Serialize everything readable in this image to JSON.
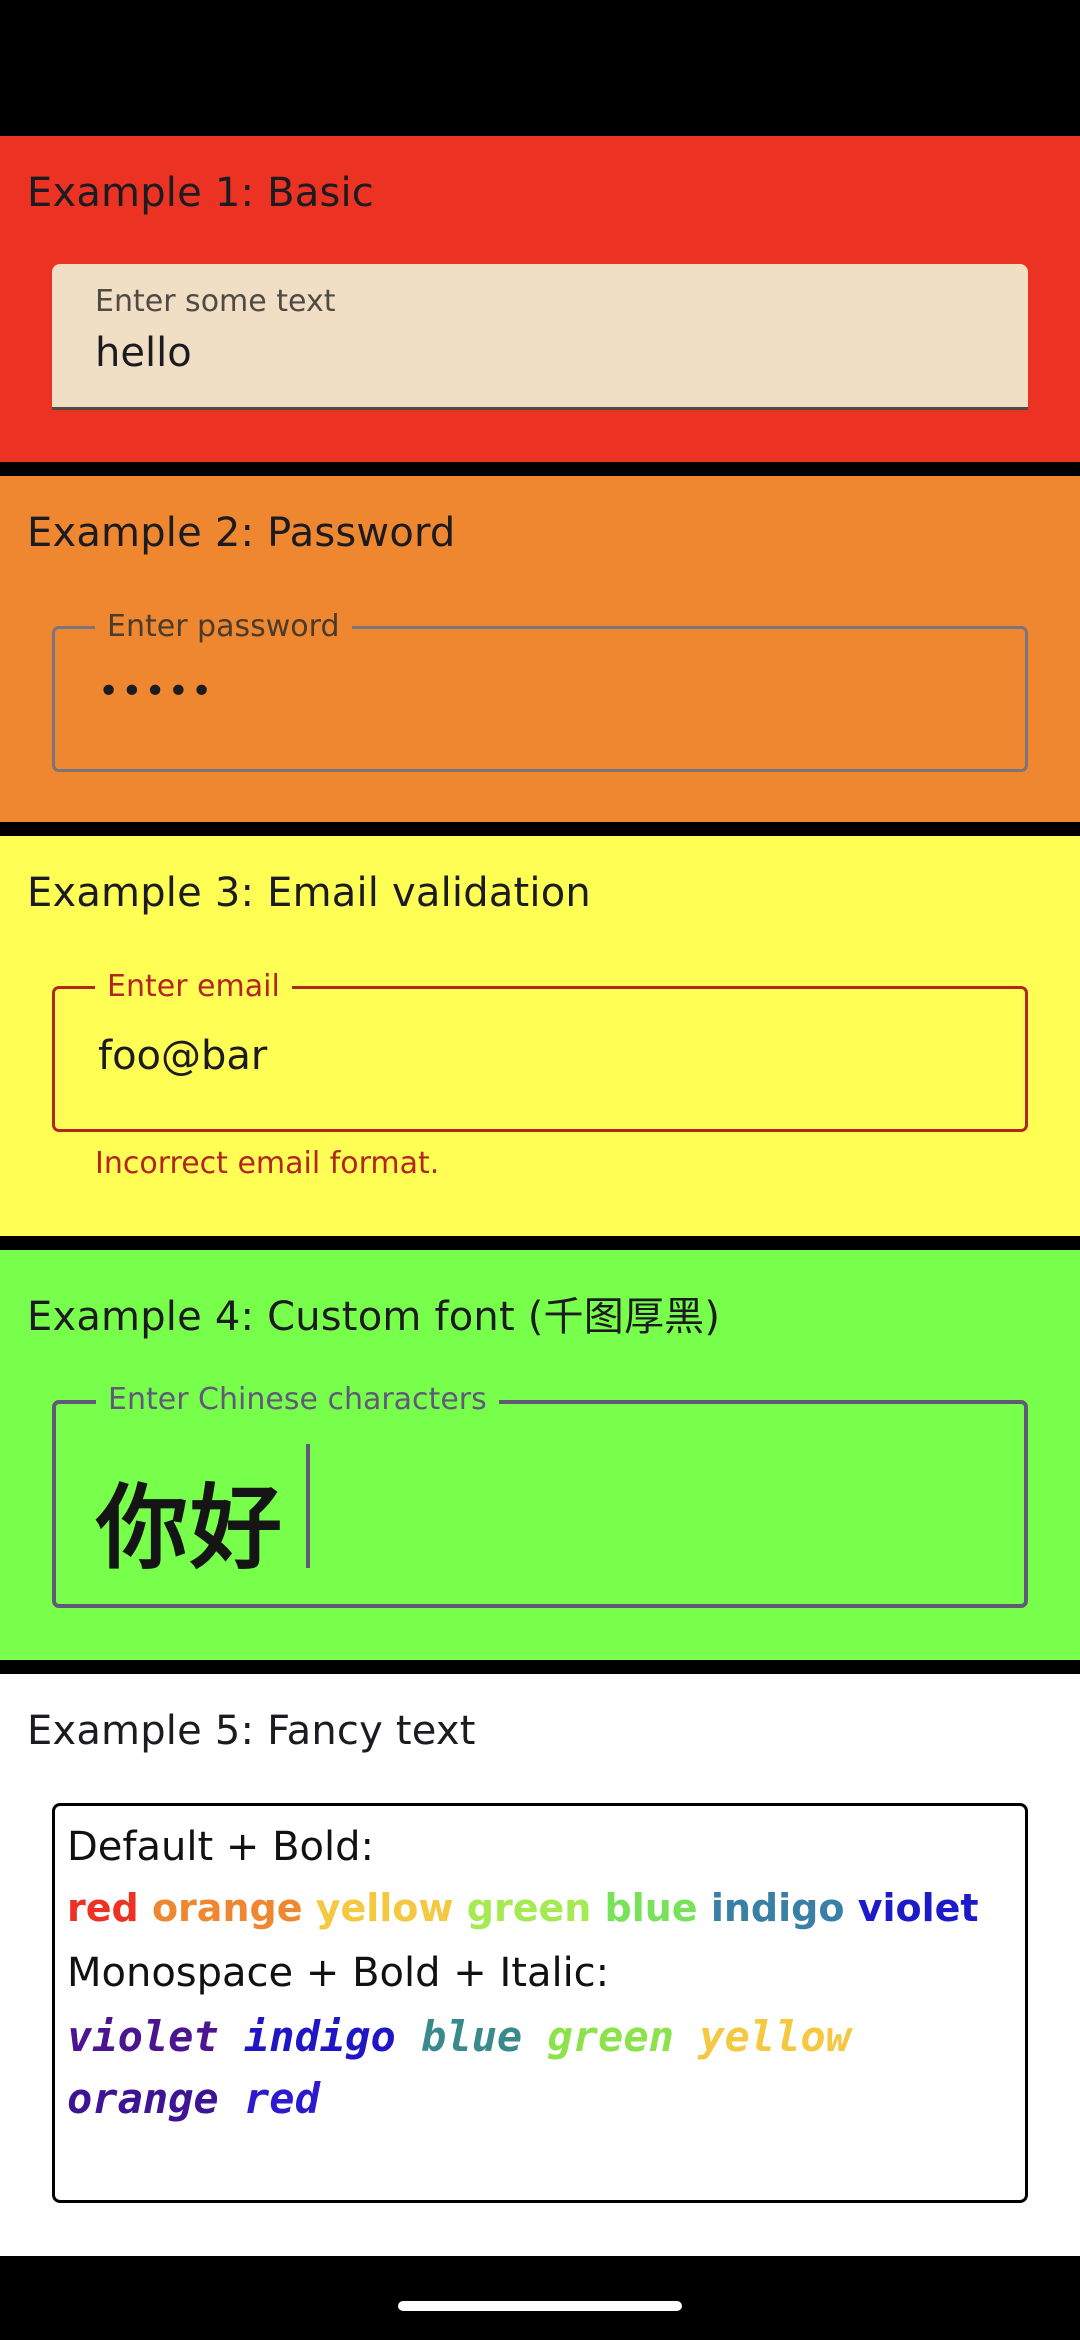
{
  "colors": {
    "red": "#eb3223",
    "orange": "#ef8730",
    "yellow": "#fffe55",
    "green": "#78ff4c",
    "white": "#ffffff",
    "error": "#b3261e"
  },
  "examples": [
    {
      "title": "Example 1: Basic",
      "field": {
        "type": "filled",
        "label": "Enter some text",
        "value": "hello"
      }
    },
    {
      "title": "Example 2: Password",
      "field": {
        "type": "outlined",
        "label": "Enter password",
        "value": "•••••"
      }
    },
    {
      "title": "Example 3: Email validation",
      "field": {
        "type": "outlined-error",
        "label": "Enter email",
        "value": "foo@bar",
        "error": "Incorrect email format."
      }
    },
    {
      "title": "Example 4: Custom font (千图厚黑)",
      "field": {
        "type": "outlined-focused",
        "label": "Enter Chinese characters",
        "value": "你好"
      }
    },
    {
      "title": "Example 5: Fancy text",
      "fancy": {
        "line1": "Default + Bold:",
        "rainbow_bold": [
          "red",
          "orange",
          "yellow",
          "green",
          "blue",
          "indigo",
          "violet"
        ],
        "rainbow_bold_colors": [
          "#eb3223",
          "#ef8730",
          "#f5c842",
          "#a6ea53",
          "#78e25a",
          "#3a7fa6",
          "#1d1ac9"
        ],
        "line3": "Monospace + Bold + Italic:",
        "rainbow_mono_line1": [
          "violet",
          "indigo",
          "blue",
          "green",
          "yellow"
        ],
        "rainbow_mono_line1_colors": [
          "#4a158f",
          "#2016c6",
          "#3a8a8c",
          "#8be24b",
          "#f5c842"
        ],
        "rainbow_mono_line2": [
          "orange",
          "red"
        ],
        "rainbow_mono_line2_colors": [
          "#3d1493",
          "#2d1ad0"
        ]
      }
    }
  ]
}
